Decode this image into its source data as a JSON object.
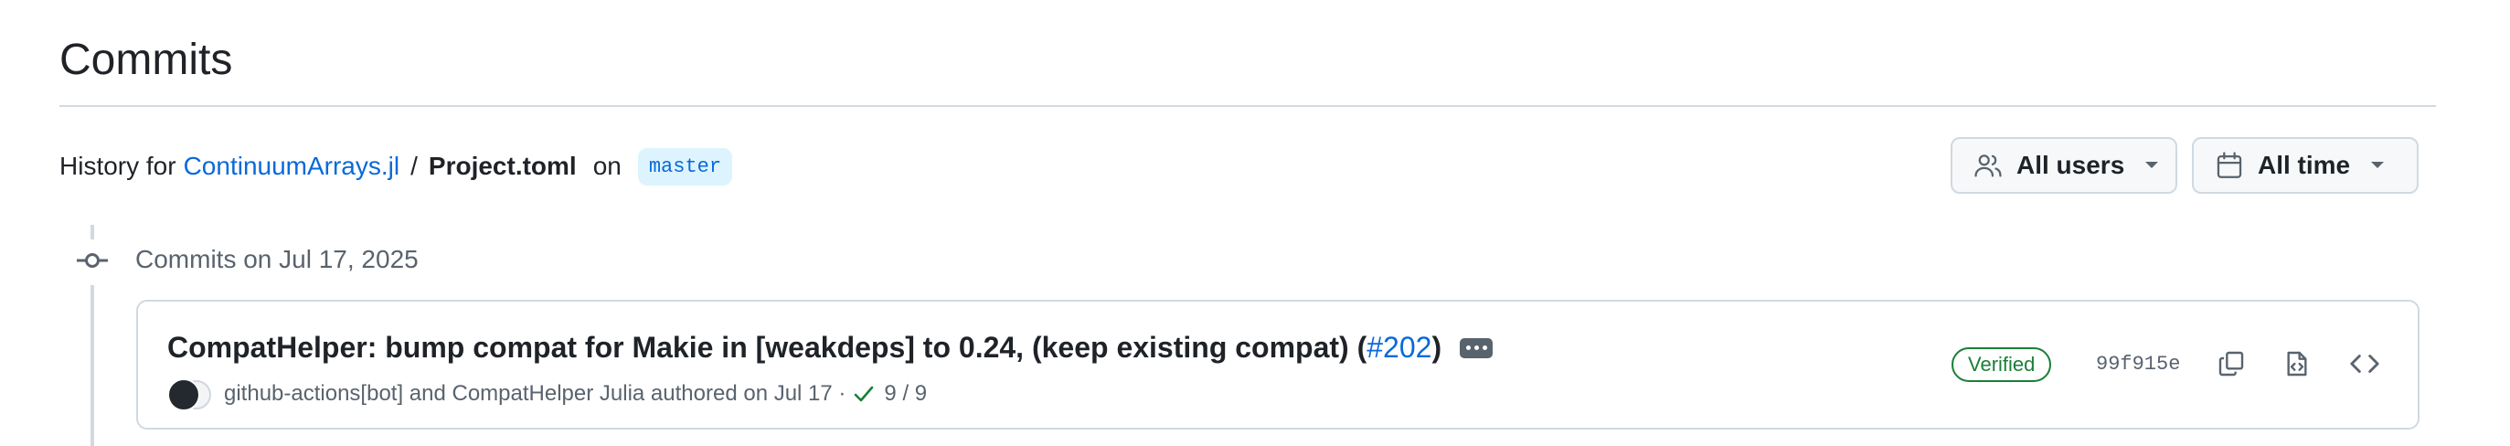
{
  "page": {
    "title": "Commits"
  },
  "history": {
    "prefix": "History for",
    "repo": "ContinuumArrays.jl",
    "separator": "/",
    "file": "Project.toml",
    "on": "on",
    "branch": "master"
  },
  "filters": {
    "users_label": "All users",
    "time_label": "All time"
  },
  "commit_groups": [
    {
      "label": "Commits on Jul 17, 2025",
      "commits": [
        {
          "message": "CompatHelper: bump compat for Makie in [weakdeps] to 0.24, (keep existing compat) (",
          "pr": "#202",
          "message_end": ")",
          "authors": "github-actions[bot] and CompatHelper Julia authored on Jul 17 ·",
          "checks": "9 / 9",
          "verified": "Verified",
          "sha": "99f915e"
        }
      ]
    }
  ],
  "colors": {
    "link": "#0969da",
    "border": "#d1d9e0",
    "verified": "#1a7f37",
    "muted": "#59636e"
  },
  "icons": [
    "people-icon",
    "calendar-icon",
    "caret-down-icon",
    "git-commit-icon",
    "check-icon",
    "copy-icon",
    "file-code-icon",
    "code-icon",
    "ellipsis-icon"
  ]
}
